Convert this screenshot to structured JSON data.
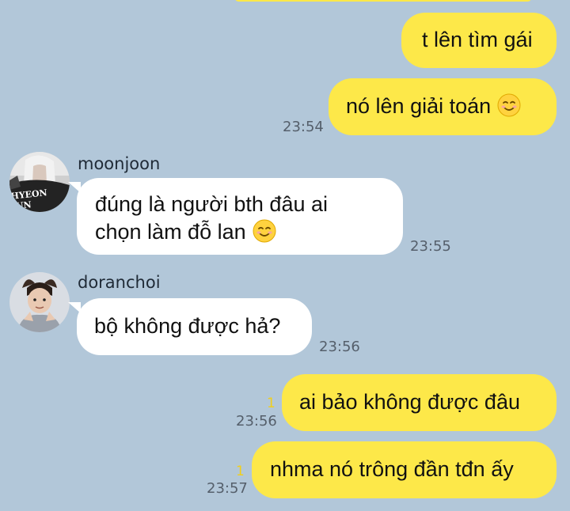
{
  "messages": [
    {
      "sender": "me",
      "text": "t lên tìm gái"
    },
    {
      "sender": "me",
      "text": "nó lên giải toán",
      "emoji": "smiling-face-emoji",
      "time": "23:54"
    },
    {
      "sender": "moonjoon",
      "avatar_text": "HYEON JUN",
      "lines": [
        "đúng là người bth đâu ai",
        "chọn làm đỗ lan"
      ],
      "emoji": "smiling-face-emoji",
      "time": "23:55"
    },
    {
      "sender": "doranchoi",
      "text": "bộ không được hả?",
      "time": "23:56"
    },
    {
      "sender": "me",
      "text": "ai bảo không được đâu",
      "unread": "1",
      "time": "23:56"
    },
    {
      "sender": "me",
      "text": "nhma nó trông đần tđn ấy",
      "unread": "1",
      "time": "23:57"
    }
  ],
  "colors": {
    "background": "#b2c7d9",
    "my_bubble": "#fde849",
    "their_bubble": "#ffffff",
    "unread_count": "#f2cf1a"
  }
}
